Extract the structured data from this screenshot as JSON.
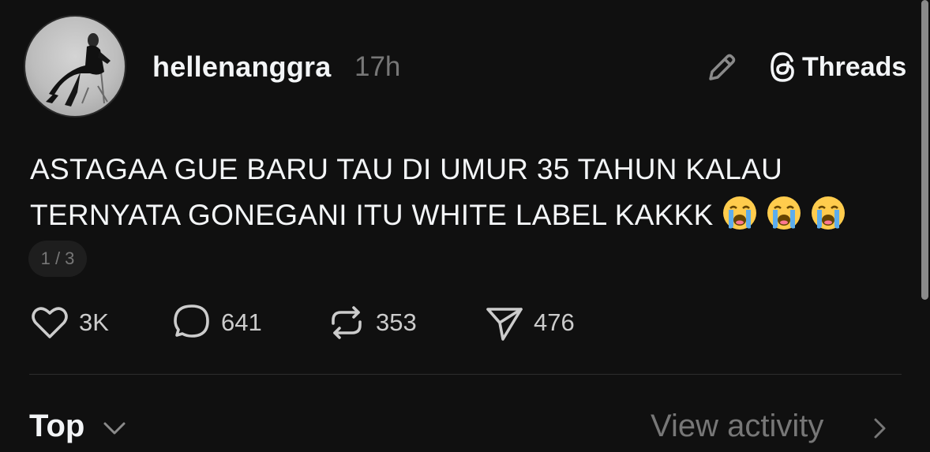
{
  "post": {
    "username": "hellenanggra",
    "timestamp": "17h",
    "text": "ASTAGAA GUE BARU TAU DI UMUR 35 TAHUN KALAU\nTERNYATA GONEGANI ITU WHITE LABEL KAKKK",
    "emojis": [
      "loudly-crying-face",
      "loudly-crying-face",
      "loudly-crying-face"
    ],
    "page_indicator": "1 / 3"
  },
  "header": {
    "app_name": "Threads"
  },
  "actions": {
    "likes": "3K",
    "replies": "641",
    "reposts": "353",
    "shares": "476"
  },
  "replies_section": {
    "sort_label": "Top",
    "view_activity_label": "View activity"
  },
  "colors": {
    "background": "#101010",
    "primary_text": "#f3f5f7",
    "secondary_text": "#777777"
  }
}
